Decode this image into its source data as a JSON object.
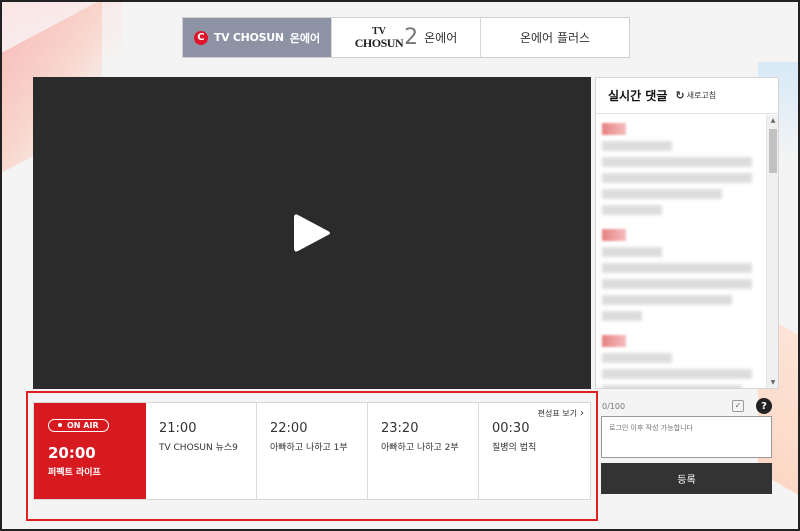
{
  "tabs": [
    {
      "brand": "TV CHOSUN",
      "label": "온에어",
      "logo_letter": "C",
      "active": true
    },
    {
      "logo_tv": "TV",
      "logo_chosun": "CHOSUN",
      "logo_num": "2",
      "label": "온에어",
      "active": false
    },
    {
      "label": "온에어 플러스",
      "active": false
    }
  ],
  "player": {
    "play_icon": "play-icon"
  },
  "chat": {
    "title": "실시간 댓글",
    "refresh_label": "새로고침",
    "refresh_icon": "↻"
  },
  "comment": {
    "count": "0/100",
    "placeholder": "로그인 이후 작성 가능합니다",
    "help": "?",
    "submit_label": "등록"
  },
  "schedule": {
    "link_label": "편성표 보기",
    "onair": {
      "badge": "ON AIR",
      "time": "20:00",
      "title": "퍼펙트 라이프"
    },
    "slots": [
      {
        "time": "21:00",
        "title": "TV CHOSUN 뉴스9"
      },
      {
        "time": "22:00",
        "title": "아빠하고 나하고 1부"
      },
      {
        "time": "23:20",
        "title": "아빠하고 나하고 2부"
      },
      {
        "time": "00:30",
        "title": "질병의 법칙"
      }
    ]
  },
  "colors": {
    "accent_red": "#d71920",
    "tab_active": "#8d93a5",
    "button_dark": "#333333"
  }
}
